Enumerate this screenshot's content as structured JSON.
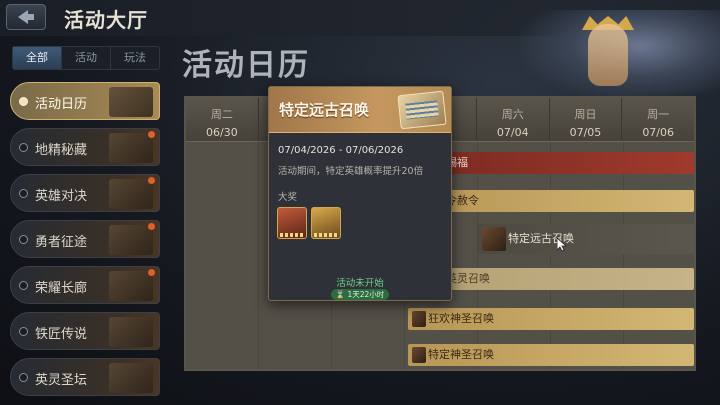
{
  "app": {
    "title": "活动大厅"
  },
  "category_tabs": [
    {
      "label": "全部",
      "active": true
    },
    {
      "label": "活动",
      "active": false
    },
    {
      "label": "玩法",
      "active": false
    }
  ],
  "sidebar": {
    "items": [
      {
        "label": "活动日历",
        "active": true,
        "badge": false
      },
      {
        "label": "地精秘藏",
        "active": false,
        "badge": true
      },
      {
        "label": "英雄对决",
        "active": false,
        "badge": true
      },
      {
        "label": "勇者征途",
        "active": false,
        "badge": true
      },
      {
        "label": "荣耀长廊",
        "active": false,
        "badge": true
      },
      {
        "label": "铁匠传说",
        "active": false,
        "badge": false
      },
      {
        "label": "英灵圣坛",
        "active": false,
        "badge": false
      }
    ]
  },
  "page_heading": "活动日历",
  "calendar": {
    "days": [
      {
        "name": "周二",
        "date": "06/30"
      },
      {
        "name": "",
        "date": ""
      },
      {
        "name": "",
        "date": ""
      },
      {
        "name": "",
        "date": ""
      },
      {
        "name": "周六",
        "date": "07/04"
      },
      {
        "name": "周日",
        "date": "07/05"
      },
      {
        "name": "周一",
        "date": "07/06"
      }
    ],
    "events": [
      {
        "label": "赐福",
        "style": "red"
      },
      {
        "label": "令赦令",
        "style": "gold"
      },
      {
        "label": "特定远古召唤",
        "style": "big"
      },
      {
        "label": "英灵召唤",
        "style": "pale"
      },
      {
        "label": "狂欢神圣召唤",
        "style": "gold"
      },
      {
        "label": "特定神圣召唤",
        "style": "gold"
      }
    ]
  },
  "popup": {
    "title": "特定远古召唤",
    "date_range": "07/04/2026 - 07/06/2026",
    "description": "活动期间，特定英雄概率提升20倍",
    "reward_label": "大奖",
    "status": "活动未开始",
    "timer": "1天22小时"
  },
  "colors": {
    "accent_gold": "#c4985f",
    "status_green": "#6fd48a",
    "event_red": "#a03a2c"
  }
}
